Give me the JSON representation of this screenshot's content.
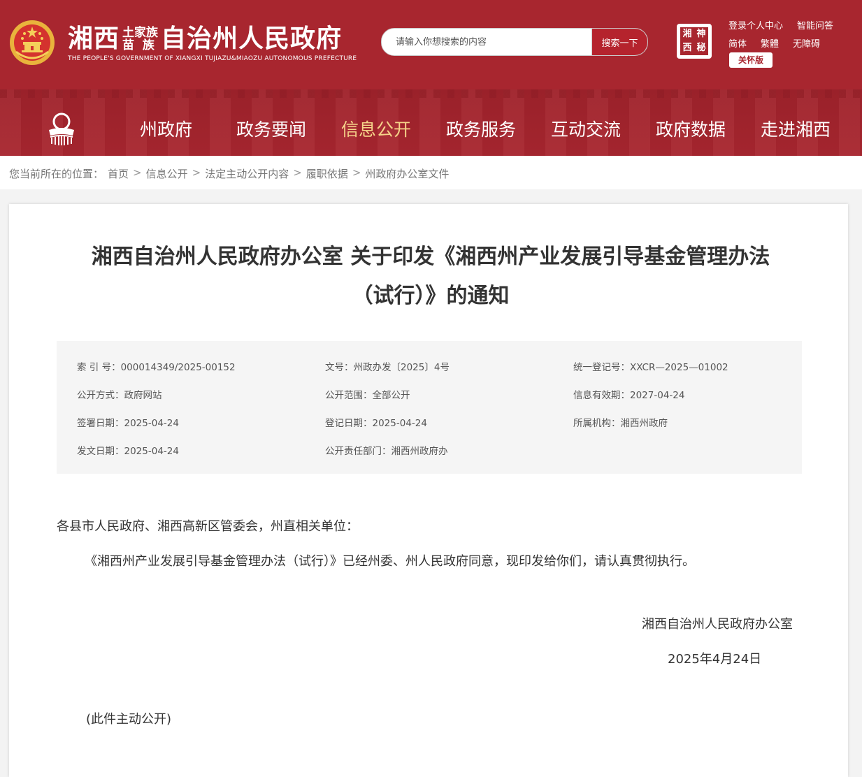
{
  "header": {
    "site_name_part1": "湘西",
    "site_name_stack_top": "土家族",
    "site_name_stack_bottom": "苗  族",
    "site_name_part2": "自治州人民政府",
    "site_name_en": "THE PEOPLE'S GOVERNMENT OF XIANGXI TUJIAZU&MIAOZU AUTONOMOUS PREFECTURE",
    "search_placeholder": "请输入你想搜索的内容",
    "search_button": "搜索一下",
    "seal_chars": [
      "湘",
      "神",
      "西",
      "秘"
    ],
    "links_row1": [
      "登录",
      "个人中心",
      "智能问答"
    ],
    "links_row2": [
      "简体",
      "繁體",
      "无障碍"
    ],
    "care_button": "关怀版",
    "colors": {
      "brand_red": "#a8262f",
      "active_nav": "#f6d48a"
    }
  },
  "nav": {
    "items": [
      "州政府",
      "政务要闻",
      "信息公开",
      "政务服务",
      "互动交流",
      "政府数据",
      "走进湘西"
    ],
    "active": "信息公开"
  },
  "breadcrumb": {
    "prefix": "您当前所在的位置：",
    "items": [
      "首页",
      "信息公开",
      "法定主动公开内容",
      "履职依据",
      "州政府办公室文件"
    ]
  },
  "article": {
    "title_line1": "湘西自治州人民政府办公室 关于印发《湘西州产业发展引导基金管理办法",
    "title_line2": "（试行）》的通知",
    "meta": {
      "index_no": "索 引 号：000014349/2025-00152",
      "doc_no": "文号：州政办发〔2025〕4号",
      "reg_no": "统一登记号：XXCR—2025—01002",
      "publish_method": "公开方式：政府网站",
      "publish_scope": "公开范围：全部公开",
      "valid_until": "信息有效期：2027-04-24",
      "sign_date": "签署日期：2025-04-24",
      "register_date": "登记日期：2025-04-24",
      "org": "所属机构：湘西州政府",
      "issue_date": "发文日期：2025-04-24",
      "dept": "公开责任部门：湘西州政府办"
    },
    "salutation": "各县市人民政府、湘西高新区管委会，州直相关单位：",
    "paragraph": "《湘西州产业发展引导基金管理办法（试行）》已经州委、州人民政府同意，现印发给你们，请认真贯彻执行。",
    "signature": "湘西自治州人民政府办公室",
    "date": "2025年4月24日",
    "note": "(此件主动公开)"
  }
}
